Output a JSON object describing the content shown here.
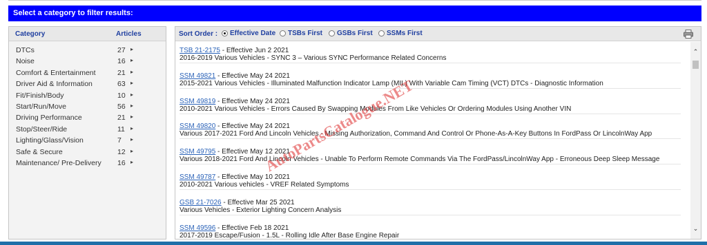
{
  "banner": {
    "text": "Select a category to filter results:"
  },
  "categories": {
    "header_category": "Category",
    "header_articles": "Articles",
    "items": [
      {
        "name": "DTCs",
        "count": "27"
      },
      {
        "name": "Noise",
        "count": "16"
      },
      {
        "name": "Comfort & Entertainment",
        "count": "21"
      },
      {
        "name": "Driver Aid & Information",
        "count": "63"
      },
      {
        "name": "Fit/Finish/Body",
        "count": "10"
      },
      {
        "name": "Start/Run/Move",
        "count": "56"
      },
      {
        "name": "Driving Performance",
        "count": "21"
      },
      {
        "name": "Stop/Steer/Ride",
        "count": "11"
      },
      {
        "name": "Lighting/Glass/Vision",
        "count": "7"
      },
      {
        "name": "Safe & Secure",
        "count": "12"
      },
      {
        "name": "Maintenance/ Pre-Delivery",
        "count": "16"
      }
    ]
  },
  "sort": {
    "label": "Sort Order :",
    "options": [
      {
        "label": "Effective Date",
        "selected": true
      },
      {
        "label": "TSBs First",
        "selected": false
      },
      {
        "label": "GSBs First",
        "selected": false
      },
      {
        "label": "SSMs First",
        "selected": false
      }
    ]
  },
  "results": [
    {
      "id": "TSB 21-2175",
      "date": " - Effective Jun 2 2021",
      "desc": "2016-2019 Various Vehicles - SYNC 3 – Various SYNC Performance Related Concerns"
    },
    {
      "id": "SSM 49821",
      "date": " - Effective May 24 2021",
      "desc": "2015-2021 Various Vehicles - Illuminated Malfunction Indicator Lamp (MIL) With Variable Cam Timing (VCT) DTCs - Diagnostic Information"
    },
    {
      "id": "SSM 49819",
      "date": " - Effective May 24 2021",
      "desc": "2010-2021 Various Vehicles - Errors Caused By Swapping Modules From Like Vehicles Or Ordering Modules Using Another VIN"
    },
    {
      "id": "SSM 49820",
      "date": " - Effective May 24 2021",
      "desc": "Various 2017-2021 Ford And Lincoln Vehicles - Missing Authorization, Command And Control Or Phone-As-A-Key Buttons In FordPass Or LincolnWay App"
    },
    {
      "id": "SSM 49795",
      "date": " - Effective May 12 2021",
      "desc": "Various 2018-2021 Ford And Lincoln Vehicles - Unable To Perform Remote Commands Via The FordPass/LincolnWay App - Erroneous Deep Sleep Message"
    },
    {
      "id": "SSM 49787",
      "date": " - Effective May 10 2021",
      "desc": "2010-2021 Various vehicles - VREF Related Symptoms"
    },
    {
      "id": "GSB 21-7026",
      "date": " - Effective Mar 25 2021",
      "desc": "Various Vehicles - Exterior Lighting Concern Analysis"
    },
    {
      "id": "SSM 49596",
      "date": " - Effective Feb 18 2021",
      "desc": "2017-2019 Escape/Fusion - 1.5L - Rolling Idle After Base Engine Repair"
    }
  ],
  "watermark": "AutoPartsCatalogue.NET",
  "icons": {
    "print": "printer-icon",
    "scroll_up": "chevron-up-icon",
    "scroll_down": "chevron-down-icon",
    "row_arrow": "triangle-right-icon"
  },
  "colors": {
    "banner": "#0000ff",
    "link": "#2a62b8",
    "header_text": "#1f3fa0",
    "footer": "#1f6fa8"
  }
}
